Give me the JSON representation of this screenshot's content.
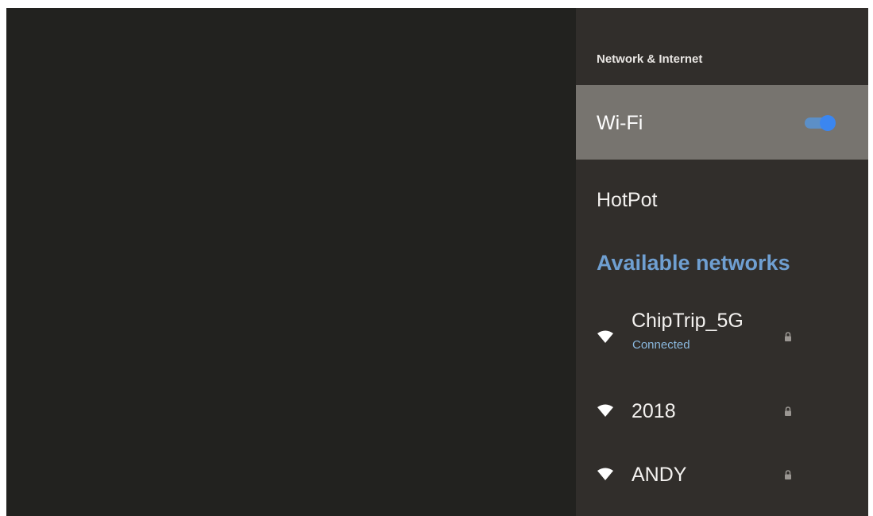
{
  "panel": {
    "title": "Network & Internet"
  },
  "wifi": {
    "label": "Wi-Fi",
    "enabled": true
  },
  "hotspot": {
    "label": "HotPot"
  },
  "available": {
    "header": "Available networks",
    "networks": [
      {
        "name": "ChipTrip_5G",
        "status": "Connected",
        "icon": "wifi-icon",
        "secured": true
      },
      {
        "name": "2018",
        "status": "",
        "icon": "wifi-icon",
        "secured": true
      },
      {
        "name": "ANDY",
        "status": "",
        "icon": "wifi-icon",
        "secured": true
      }
    ]
  },
  "colors": {
    "accent": "#6f9fd1",
    "toggle_on": "#3b86f0",
    "panel_bg": "#312e2b",
    "selected_bg": "#77746f",
    "screen_bg": "#22221f"
  }
}
